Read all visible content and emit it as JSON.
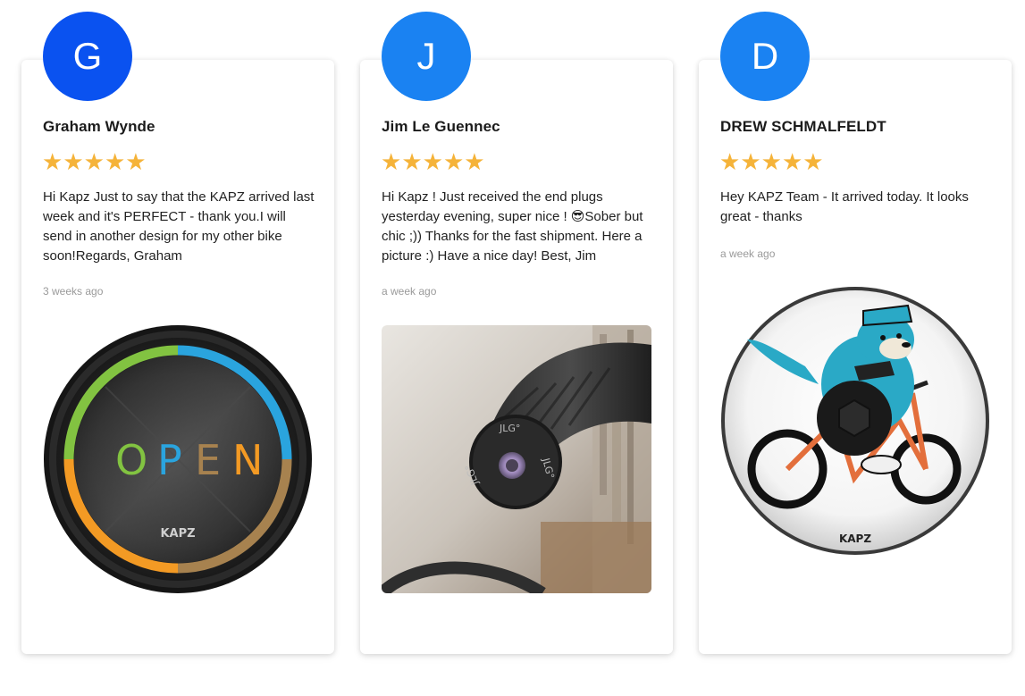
{
  "colors": {
    "star": "#f5b339",
    "avatar_g": "#0a52f0",
    "avatar_j": "#1a82f2",
    "avatar_d": "#1a82f2"
  },
  "reviews": [
    {
      "initial": "G",
      "name": "Graham Wynde",
      "rating": 5,
      "text": "Hi Kapz Just to say that the KAPZ arrived last week and it's PERFECT - thank you.I will send in another design for my other bike soon!Regards, Graham",
      "time": "3 weeks ago",
      "photo": {
        "type": "product-cap",
        "center_letters": [
          "O",
          "P",
          "E",
          "N"
        ],
        "brand": "KAPZ"
      }
    },
    {
      "initial": "J",
      "name": "Jim Le Guennec",
      "rating": 5,
      "text": "Hi Kapz ! Just received the end plugs yesterday evening, super nice ! 😎Sober but chic ;)) Thanks for the fast shipment. Here a picture :) Have a nice day! Best, Jim",
      "time": "a week ago",
      "photo": {
        "type": "handlebar-plug-photo",
        "cap_text_1": "JLG°",
        "cap_text_2": "JLG°",
        "cap_text_3": "JLG°"
      }
    },
    {
      "initial": "D",
      "name": "DREW SCHMALFELDT",
      "rating": 5,
      "text": "Hey KAPZ Team - It arrived today. It looks great - thanks",
      "time": "a week ago",
      "photo": {
        "type": "bear-bike-cap",
        "brand": "KAPZ"
      }
    }
  ]
}
